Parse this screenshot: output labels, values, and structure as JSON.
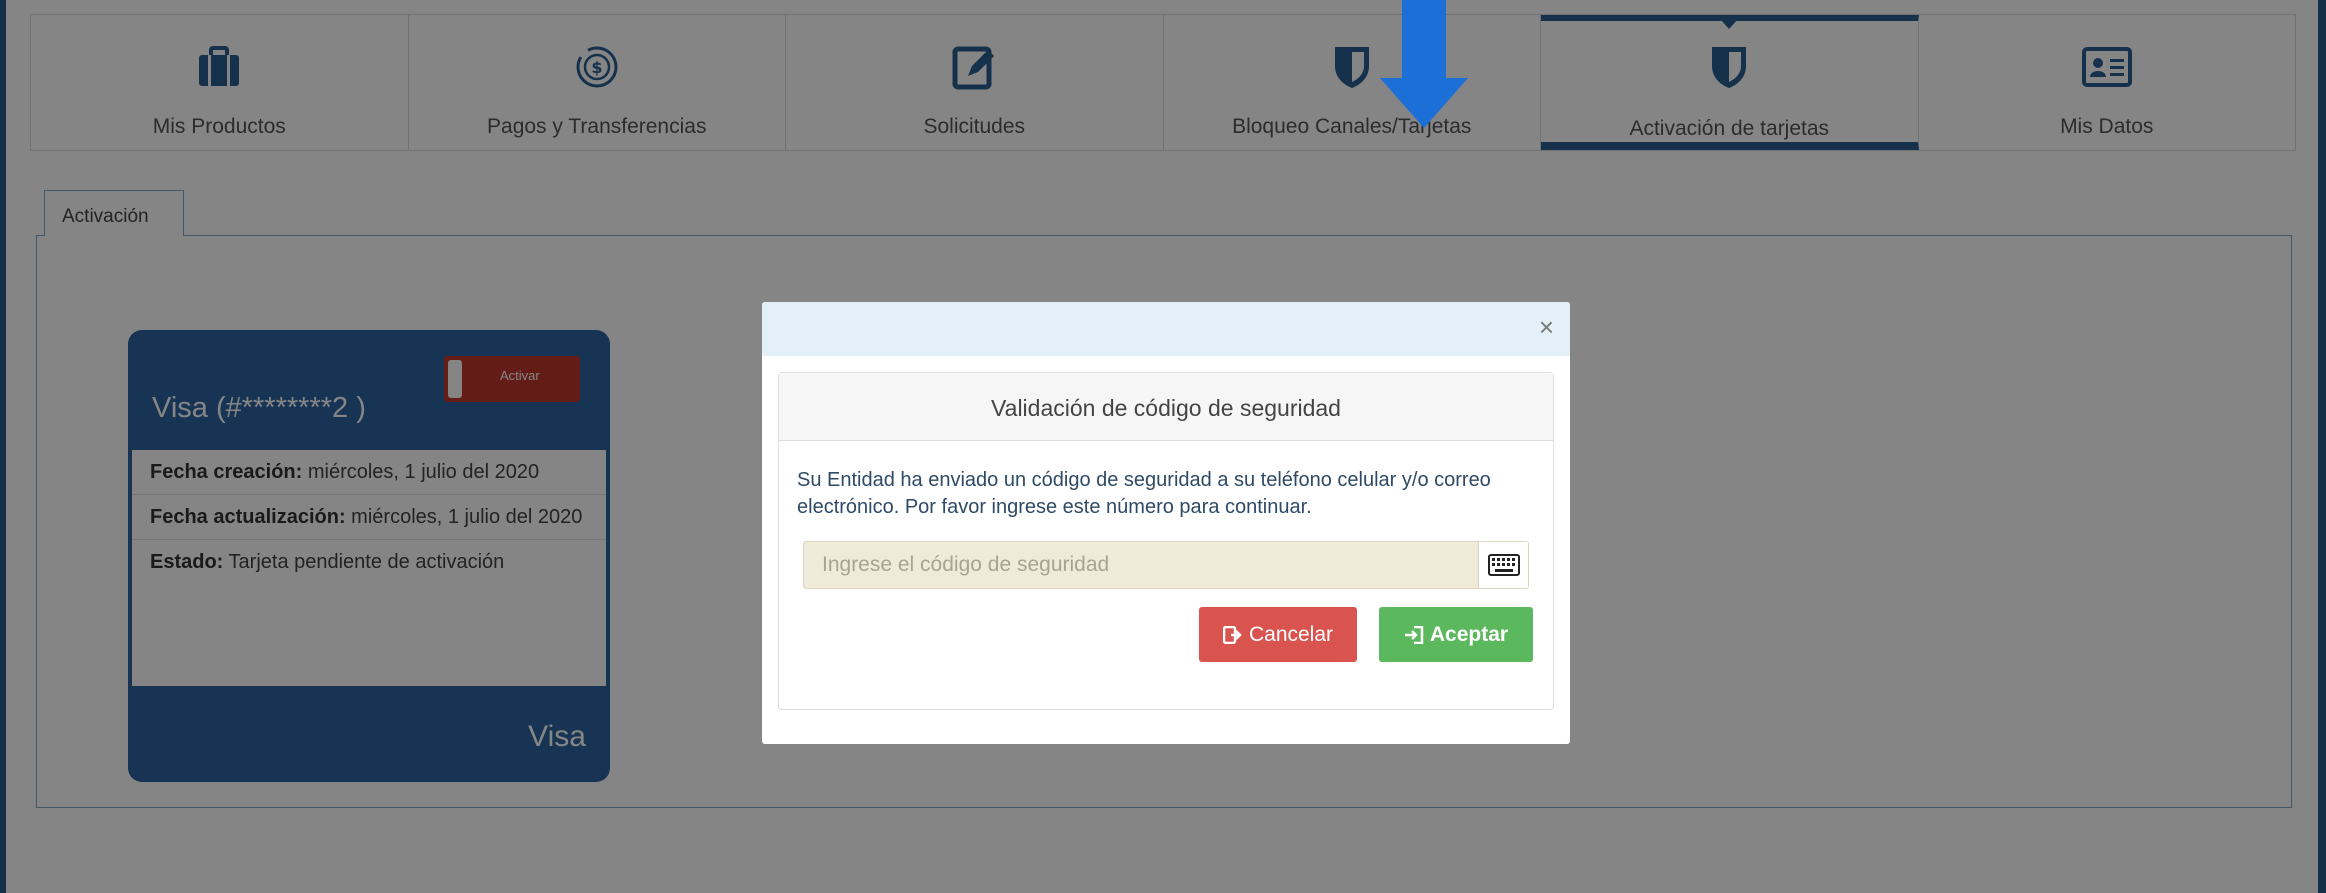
{
  "nav": {
    "items": [
      {
        "label": "Mis Productos",
        "icon": "briefcase-icon"
      },
      {
        "label": "Pagos y Transferencias",
        "icon": "money-transfer-icon"
      },
      {
        "label": "Solicitudes",
        "icon": "edit-document-icon"
      },
      {
        "label": "Bloqueo Canales/Tarjetas",
        "icon": "shield-icon"
      },
      {
        "label": "Activación de tarjetas",
        "icon": "shield-icon",
        "active": true
      },
      {
        "label": "Mis Datos",
        "icon": "id-card-icon"
      }
    ]
  },
  "tab": {
    "label": "Activación"
  },
  "card": {
    "title": "Visa (#********2   )",
    "activate_label": "Activar",
    "rows": [
      {
        "key": "Fecha creación:",
        "value": " miércoles, 1 julio del 2020"
      },
      {
        "key": "Fecha actualización:",
        "value": " miércoles, 1 julio del 2020"
      },
      {
        "key": "Estado:",
        "value": " Tarjeta pendiente de activación"
      }
    ],
    "brand": "Visa"
  },
  "modal": {
    "close": "×",
    "title": "Validación de código de seguridad",
    "message": "Su Entidad ha enviado un código de seguridad a su teléfono celular y/o correo electrónico. Por favor ingrese este número para continuar.",
    "input_placeholder": "Ingrese el código de seguridad",
    "input_value": "",
    "cancel_label": "Cancelar",
    "accept_label": "Aceptar"
  },
  "colors": {
    "primary": "#2d64a4",
    "danger": "#d9534f",
    "success": "#5cb85c",
    "arrow": "#1b6fd6"
  }
}
